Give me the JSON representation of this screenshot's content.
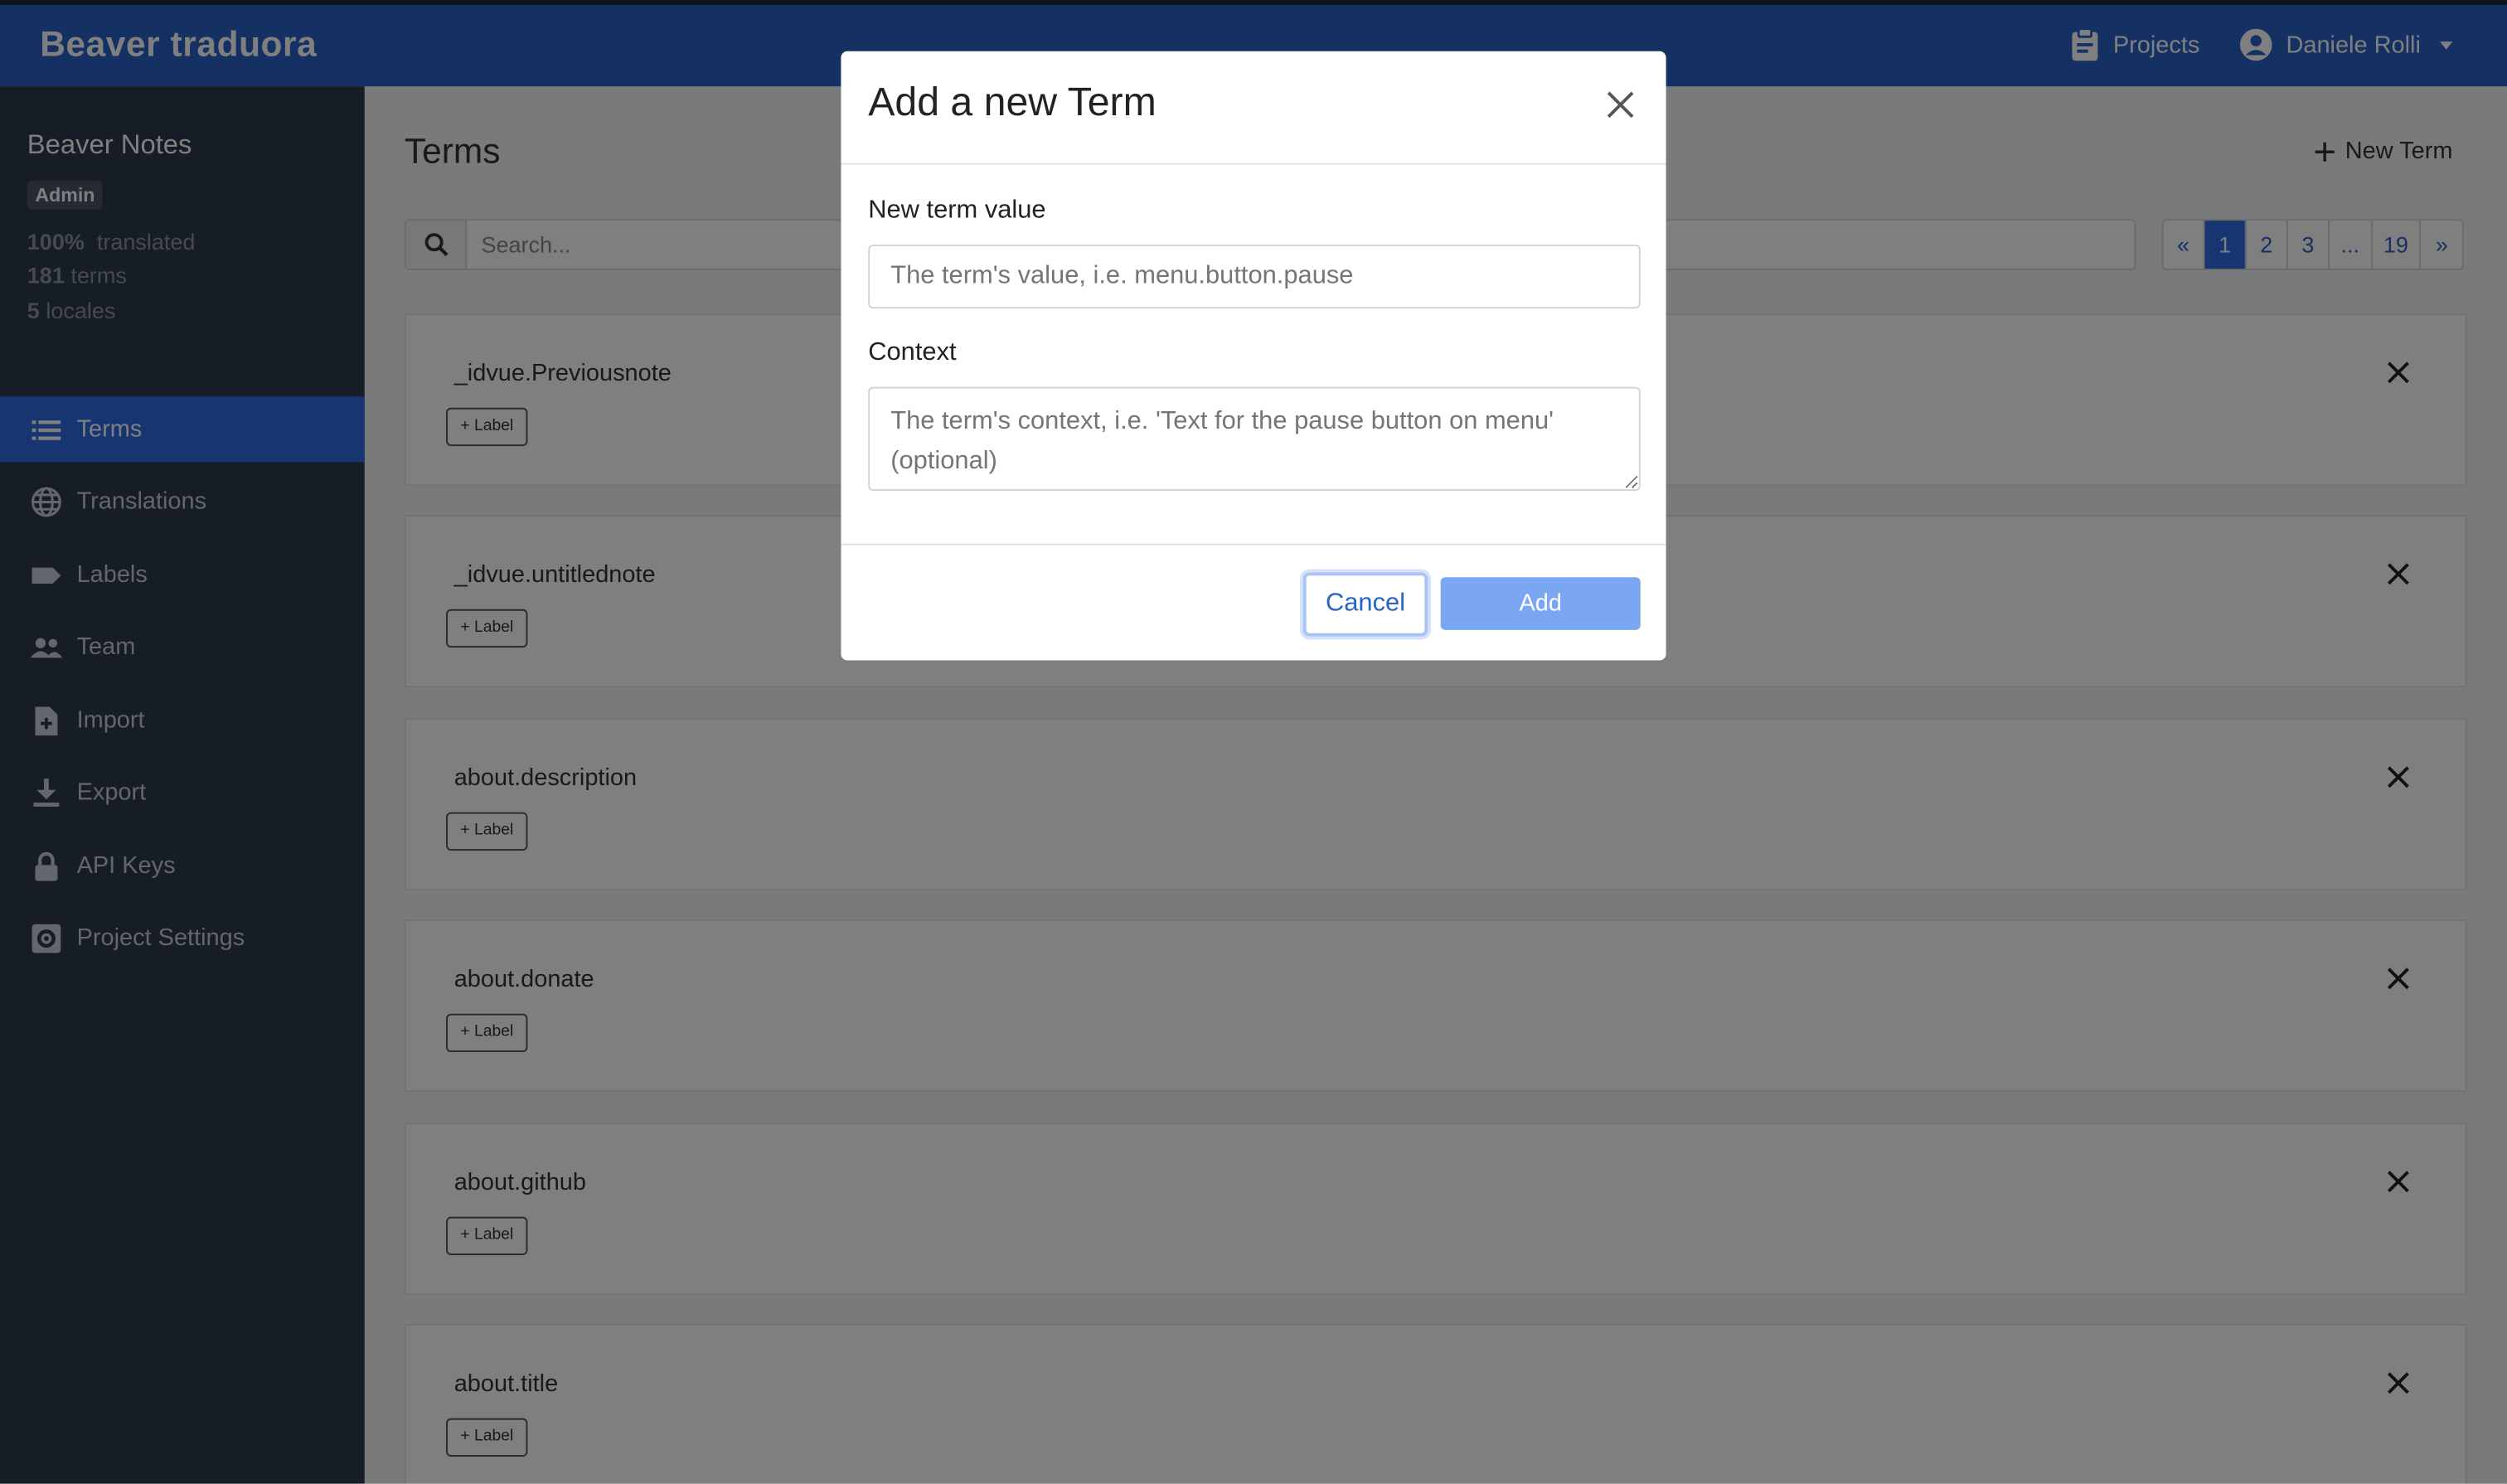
{
  "topbar": {
    "brand": "Beaver traduora",
    "projects_label": "Projects",
    "user_label": "Daniele Rolli"
  },
  "sidebar": {
    "project_name": "Beaver Notes",
    "role_badge": "Admin",
    "stats": {
      "translated_pct": "100%",
      "translated_label": "translated",
      "terms_count": "181",
      "terms_label": "terms",
      "locales_count": "5",
      "locales_label": "locales"
    },
    "items": [
      {
        "label": "Terms",
        "icon": "list-icon"
      },
      {
        "label": "Translations",
        "icon": "globe-icon"
      },
      {
        "label": "Labels",
        "icon": "tag-icon"
      },
      {
        "label": "Team",
        "icon": "people-icon"
      },
      {
        "label": "Import",
        "icon": "file-plus-icon"
      },
      {
        "label": "Export",
        "icon": "download-icon"
      },
      {
        "label": "API Keys",
        "icon": "lock-icon"
      },
      {
        "label": "Project Settings",
        "icon": "settings-icon"
      }
    ]
  },
  "main": {
    "title": "Terms",
    "new_term_label": "New Term",
    "search_placeholder": "Search...",
    "pagination": [
      "«",
      "1",
      "2",
      "3",
      "...",
      "19",
      "»"
    ],
    "pagination_active": "1",
    "label_button": "+ Label",
    "terms": [
      "_idvue.Previousnote",
      "_idvue.untitlednote",
      "about.description",
      "about.donate",
      "about.github",
      "about.title"
    ]
  },
  "modal": {
    "title": "Add a new Term",
    "term_label": "New term value",
    "term_placeholder": "The term's value, i.e. menu.button.pause",
    "context_label": "Context",
    "context_placeholder": "The term's context, i.e. 'Text for the pause button on menu' (optional)",
    "cancel_label": "Cancel",
    "add_label": "Add"
  },
  "colors": {
    "primary": "#2a63c8",
    "sidebar": "#2f3a4d",
    "active_nav": "#2f6ae0",
    "add_button_disabled": "#7aa6f2"
  }
}
